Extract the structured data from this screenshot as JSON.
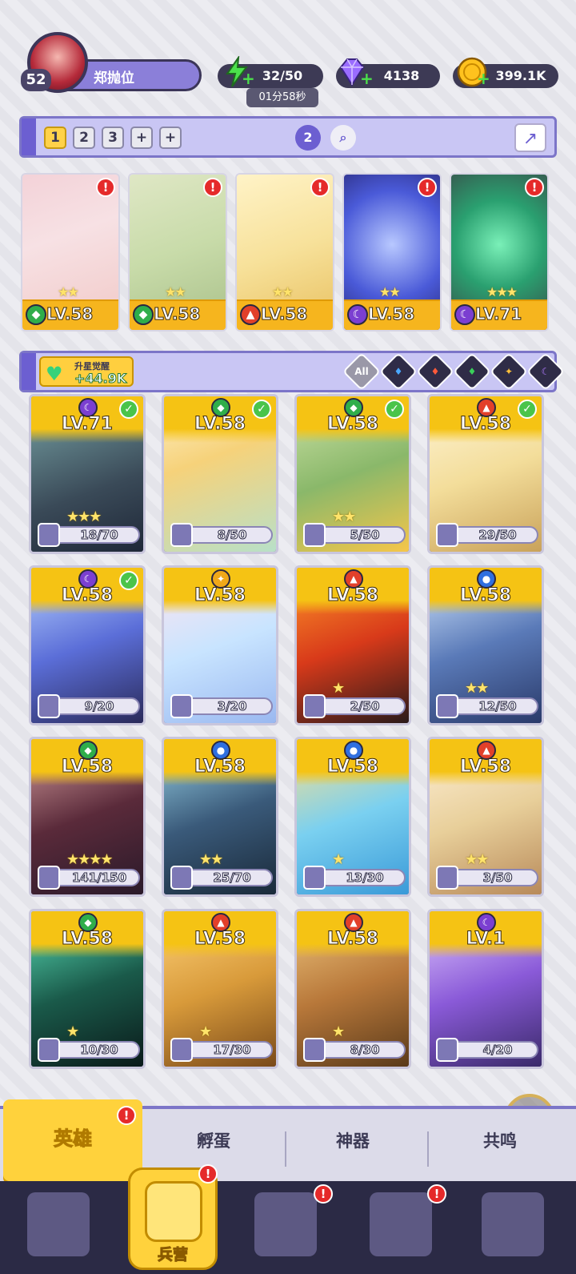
{
  "player": {
    "level": "52",
    "name": "郑抛位"
  },
  "resources": {
    "energy": "32/50",
    "energy_timer": "01分58秒",
    "gems": "4138",
    "gold": "399.1K"
  },
  "team_tabs": [
    "1",
    "2",
    "3",
    "+",
    "+"
  ],
  "team_icons": {
    "pet_badge": "2"
  },
  "team": [
    {
      "level": "LV.58",
      "element": "nature",
      "stars": "★★",
      "alert": "!"
    },
    {
      "level": "LV.58",
      "element": "nature",
      "stars": "★★",
      "alert": "!"
    },
    {
      "level": "LV.58",
      "element": "fire",
      "stars": "★★",
      "alert": "!"
    },
    {
      "level": "LV.58",
      "element": "dark",
      "stars": "★★",
      "alert": "!"
    },
    {
      "level": "LV.71",
      "element": "dark",
      "stars": "★★★",
      "alert": "!"
    }
  ],
  "awaken": {
    "label": "升星觉醒",
    "value": "+44.9K"
  },
  "filters": [
    "All",
    "water",
    "fire",
    "nature",
    "light",
    "dark"
  ],
  "heroes": [
    {
      "level": "LV.71",
      "element": "dark",
      "stars": "★★★",
      "progress": "18/70",
      "checked": true
    },
    {
      "level": "LV.58",
      "element": "nature",
      "stars": "",
      "progress": "8/50",
      "checked": true
    },
    {
      "level": "LV.58",
      "element": "nature",
      "stars": "★★",
      "progress": "5/50",
      "checked": true
    },
    {
      "level": "LV.58",
      "element": "fire",
      "stars": "",
      "progress": "29/50",
      "checked": true
    },
    {
      "level": "LV.58",
      "element": "dark",
      "stars": "",
      "progress": "9/20",
      "checked": true
    },
    {
      "level": "LV.58",
      "element": "light",
      "stars": "",
      "progress": "3/20",
      "checked": false
    },
    {
      "level": "LV.58",
      "element": "fire",
      "stars": "★",
      "progress": "2/50",
      "checked": false
    },
    {
      "level": "LV.58",
      "element": "water",
      "stars": "★★",
      "progress": "12/50",
      "checked": false
    },
    {
      "level": "LV.58",
      "element": "nature",
      "stars": "★★★★",
      "progress": "141/150",
      "checked": false
    },
    {
      "level": "LV.58",
      "element": "water",
      "stars": "★★",
      "progress": "25/70",
      "checked": false
    },
    {
      "level": "LV.58",
      "element": "water",
      "stars": "★",
      "progress": "13/30",
      "checked": false
    },
    {
      "level": "LV.58",
      "element": "fire",
      "stars": "★★",
      "progress": "3/50",
      "checked": false
    },
    {
      "level": "LV.58",
      "element": "nature",
      "stars": "★",
      "progress": "10/30",
      "checked": false
    },
    {
      "level": "LV.58",
      "element": "fire",
      "stars": "★",
      "progress": "17/30",
      "checked": false
    },
    {
      "level": "LV.58",
      "element": "fire",
      "stars": "★",
      "progress": "8/30",
      "checked": false
    },
    {
      "level": "LV.1",
      "element": "dark",
      "stars": "",
      "progress": "4/20",
      "checked": false
    }
  ],
  "sub_tabs": {
    "heroes": "英雄",
    "hatch": "孵蛋",
    "artifacts": "神器",
    "resonance": "共鸣"
  },
  "nav": {
    "barracks": "兵营"
  },
  "colors": {
    "water": "#2f6fe0",
    "fire": "#e2402a",
    "nature": "#2fae4a",
    "light": "#f0a818",
    "dark": "#7b3fd1"
  }
}
